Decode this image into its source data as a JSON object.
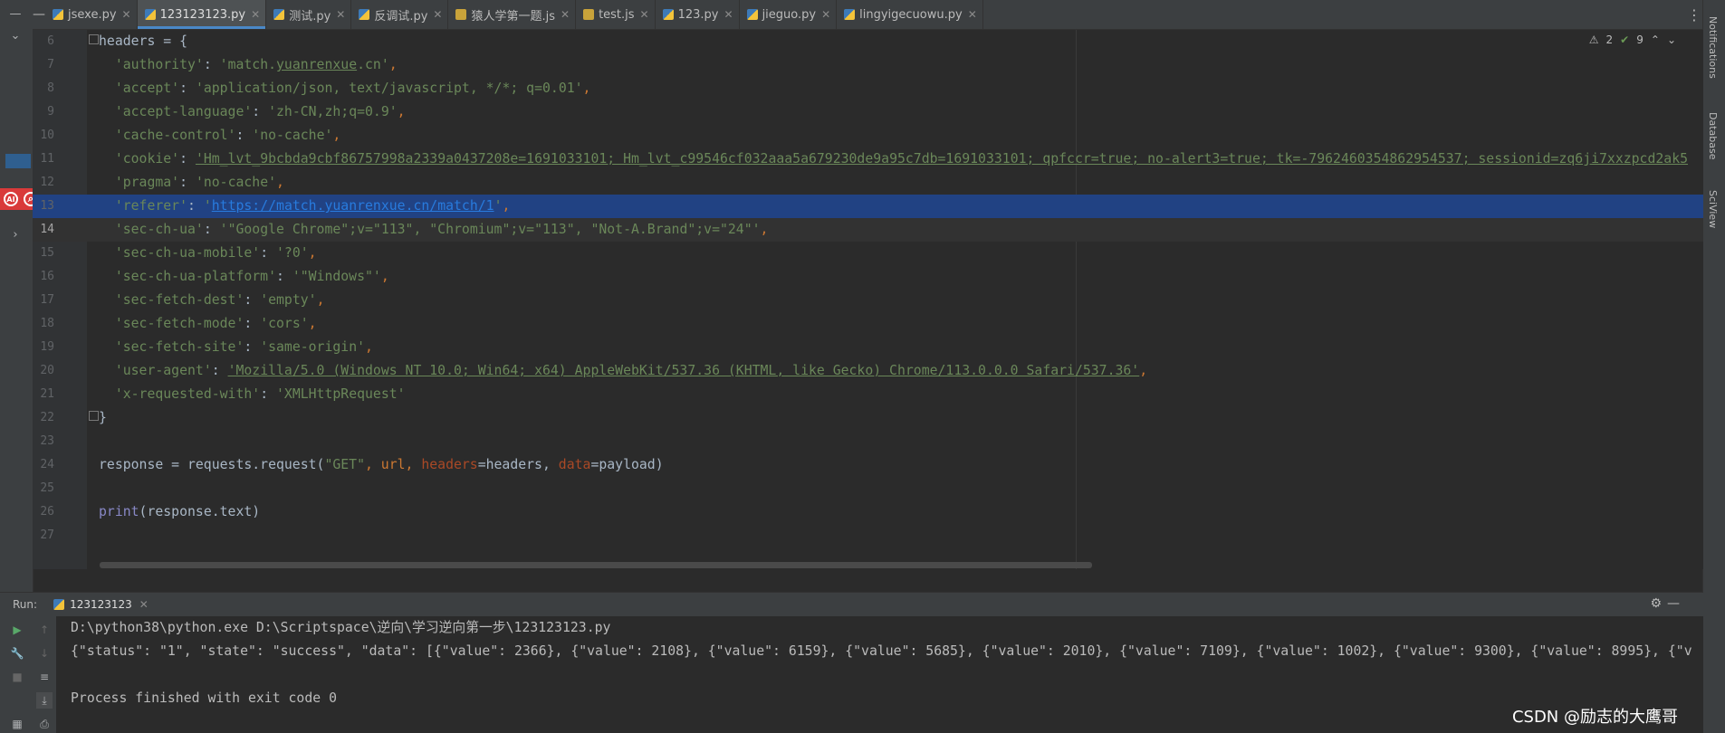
{
  "tabs": [
    {
      "label": "jsexe.py",
      "type": "py",
      "active": false
    },
    {
      "label": "123123123.py",
      "type": "py",
      "active": true
    },
    {
      "label": "测试.py",
      "type": "py",
      "active": false
    },
    {
      "label": "反调试.py",
      "type": "py",
      "active": false
    },
    {
      "label": "猿人学第一题.js",
      "type": "js",
      "active": false
    },
    {
      "label": "test.js",
      "type": "js",
      "active": false
    },
    {
      "label": "123.py",
      "type": "py",
      "active": false
    },
    {
      "label": "jieguo.py",
      "type": "py",
      "active": false
    },
    {
      "label": "lingyigecuowu.py",
      "type": "py",
      "active": false
    }
  ],
  "inspection": {
    "warnings": "2",
    "ok": "9"
  },
  "right_toolwindows": [
    "Notifications",
    "Database",
    "SciView"
  ],
  "editor": {
    "line_numbers": [
      "6",
      "7",
      "8",
      "9",
      "10",
      "11",
      "12",
      "13",
      "14",
      "15",
      "16",
      "17",
      "18",
      "19",
      "20",
      "21",
      "22",
      "23",
      "24",
      "25",
      "26",
      "27"
    ],
    "current_line": "14",
    "highlighted_line": "13",
    "lines": {
      "l6": "headers = {",
      "l7": [
        "'authority'",
        ": ",
        "'match.",
        "yuanrenxue",
        ".cn'",
        ","
      ],
      "l8": [
        "'accept'",
        ": ",
        "'application/json, text/javascript, */*; q=0.01'",
        ","
      ],
      "l9": [
        "'accept-language'",
        ": ",
        "'zh-CN,zh;q=0.9'",
        ","
      ],
      "l10": [
        "'cache-control'",
        ": ",
        "'no-cache'",
        ","
      ],
      "l11": [
        "'cookie'",
        ": ",
        "'Hm_lvt_9bcbda9cbf86757998a2339a0437208e=1691033101; Hm_lvt_c99546cf032aaa5a679230de9a95c7db=1691033101; qpfccr=true; no-alert3=true; tk=-7962460354862954537; sessionid=zq6ji7xxzpcd2ak5"
      ],
      "l12": [
        "'pragma'",
        ": ",
        "'no-cache'",
        ","
      ],
      "l13": [
        "'referer'",
        ": ",
        "'",
        "https://match.yuanrenxue.cn/match/1",
        "'",
        ","
      ],
      "l14": [
        "'sec-ch-ua'",
        ": ",
        "'\"Google Chrome\";v=\"113\", \"Chromium\";v=\"113\", \"Not-A.Brand\";v=\"24\"'",
        ","
      ],
      "l15": [
        "'sec-ch-ua-mobile'",
        ": ",
        "'?0'",
        ","
      ],
      "l16": [
        "'sec-ch-ua-platform'",
        ": ",
        "'\"Windows\"'",
        ","
      ],
      "l17": [
        "'sec-fetch-dest'",
        ": ",
        "'empty'",
        ","
      ],
      "l18": [
        "'sec-fetch-mode'",
        ": ",
        "'cors'",
        ","
      ],
      "l19": [
        "'sec-fetch-site'",
        ": ",
        "'same-origin'",
        ","
      ],
      "l20": [
        "'user-agent'",
        ": ",
        "'Mozilla/5.0 (Windows NT 10.0; Win64; x64) AppleWebKit/537.36 (KHTML, like Gecko) Chrome/113.0.0.0 Safari/537.36'",
        ","
      ],
      "l21": [
        "'x-requested-with'",
        ": ",
        "'XMLHttpRequest'"
      ],
      "l22": "}",
      "l24": [
        "response = requests.request(",
        "\"GET\"",
        ", url, ",
        "headers",
        "=headers, ",
        "data",
        "=payload)"
      ],
      "l26": [
        "print",
        "(response.text)"
      ]
    }
  },
  "run": {
    "label": "Run:",
    "tab": "123123123",
    "console": [
      "D:\\python38\\python.exe D:\\Scriptspace\\逆向\\学习逆向第一步\\123123123.py",
      "{\"status\": \"1\", \"state\": \"success\", \"data\": [{\"value\": 2366}, {\"value\": 2108}, {\"value\": 6159}, {\"value\": 5685}, {\"value\": 2010}, {\"value\": 7109}, {\"value\": 1002}, {\"value\": 9300}, {\"value\": 8995}, {\"v",
      "",
      "Process finished with exit code 0"
    ]
  },
  "watermark": "CSDN @励志的大鹰哥",
  "colors": {
    "string": "#6a8759",
    "keyword": "#cc7832",
    "param": "#aa4926",
    "builtin": "#8888c6",
    "selection": "#214283",
    "text": "#a9b7c6"
  }
}
